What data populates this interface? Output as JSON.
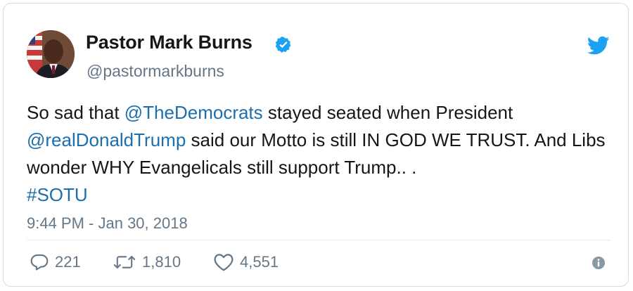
{
  "author": {
    "name": "Pastor Mark Burns",
    "handle": "@pastormarkburns",
    "verified": true
  },
  "tweet": {
    "segments": [
      {
        "text": "So sad that ",
        "type": "text"
      },
      {
        "text": "@TheDemocrats",
        "type": "link"
      },
      {
        "text": " stayed seated when President ",
        "type": "text"
      },
      {
        "text": "@realDonaldTrump",
        "type": "link"
      },
      {
        "text": " said our Motto is still IN GOD WE TRUST. And Libs wonder WHY Evangelicals still support Trump.. . ",
        "type": "text"
      },
      {
        "text": "#SOTU",
        "type": "link"
      }
    ],
    "timestamp": "9:44 PM - Jan 30, 2018"
  },
  "actions": {
    "replies": "221",
    "retweets": "1,810",
    "likes": "4,551"
  },
  "icons": {
    "brand": "twitter-bird-icon",
    "verified": "verified-badge-icon",
    "reply": "reply-icon",
    "retweet": "retweet-icon",
    "like": "heart-icon",
    "info": "info-icon"
  },
  "colors": {
    "link": "#1b6fae",
    "brand": "#1da1f2",
    "text": "#14171a",
    "muted": "#657786"
  }
}
